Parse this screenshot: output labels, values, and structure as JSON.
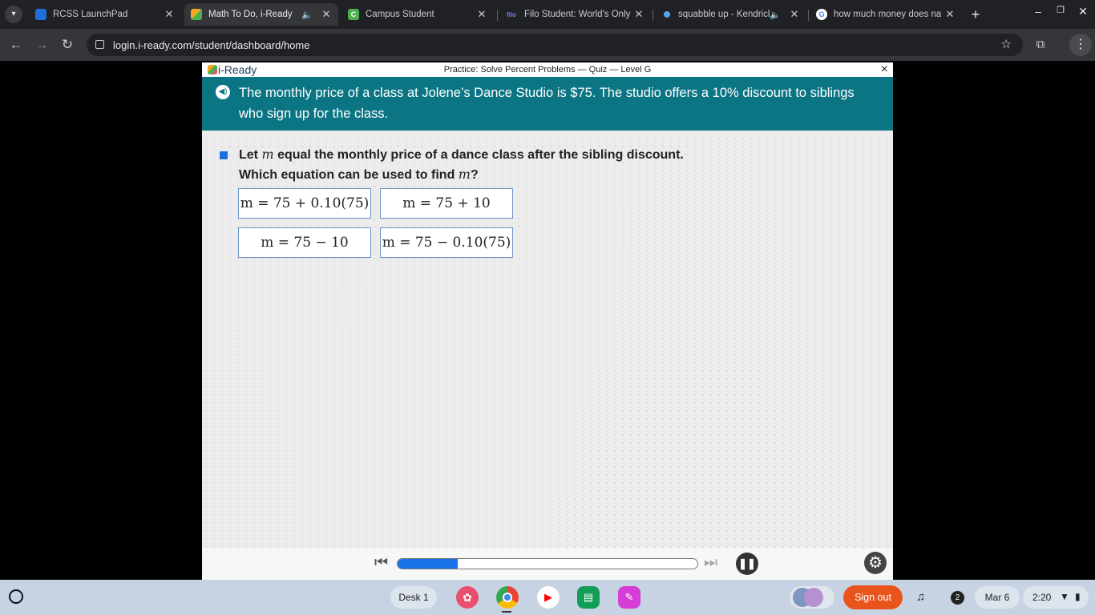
{
  "browser": {
    "tabs": [
      {
        "title": "RCSS LaunchPad",
        "favicon": "launchpad-icon"
      },
      {
        "title": "Math To Do, i-Ready",
        "favicon": "iready-icon",
        "active": true,
        "audio": true
      },
      {
        "title": "Campus Student",
        "favicon": "campus-icon"
      },
      {
        "title": "Filo Student: World's Only",
        "favicon": "filo-icon",
        "favicon_text": "filo"
      },
      {
        "title": "squabble up - Kendrick",
        "favicon": "music-icon",
        "audio": true
      },
      {
        "title": "how much money does na",
        "favicon": "google-icon",
        "favicon_text": "G"
      }
    ],
    "url": "login.i-ready.com/student/dashboard/home"
  },
  "app": {
    "logo": "i-Ready",
    "header_title": "Practice: Solve Percent Problems — Quiz — Level G",
    "close_symbol": "×",
    "question_text": "The monthly price of a class at Jolene’s Dance Studio is $75. The studio offers a 10% discount to siblings who sign up for the class.",
    "prompt_line1_prefix": "Let ",
    "prompt_variable": "m",
    "prompt_line1_suffix": " equal the monthly price of a dance class after the sibling discount.",
    "prompt_line2_prefix": "Which equation can be used to find ",
    "prompt_line2_suffix": "?",
    "options": [
      "m = 75 + 0.10(75)",
      "m = 75 + 10",
      "m = 75 − 10",
      "m = 75 − 0.10(75)"
    ],
    "progress_fraction": 0.2
  },
  "shelf": {
    "desk_label": "Desk 1",
    "sign_out_label": "Sign out",
    "notification_count": "2",
    "date": "Mar 6",
    "time": "2:20"
  },
  "colors": {
    "teal": "#0c7584",
    "progress": "#1a73e8",
    "sign_out": "#e8541c",
    "option_border": "#6b95c4"
  }
}
